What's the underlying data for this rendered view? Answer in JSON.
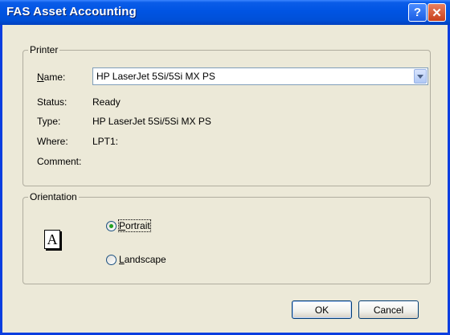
{
  "window": {
    "title": "FAS Asset Accounting",
    "help_glyph": "?",
    "close_glyph": "✕"
  },
  "printer": {
    "legend": "Printer",
    "name_label_underlined": "N",
    "name_label_rest": "ame:",
    "name_value": "HP LaserJet 5Si/5Si MX PS",
    "status_label": "Status:",
    "status_value": "Ready",
    "type_label": "Type:",
    "type_value": "HP LaserJet 5Si/5Si MX PS",
    "where_label": "Where:",
    "where_value": "LPT1:",
    "comment_label": "Comment:",
    "comment_value": ""
  },
  "orientation": {
    "legend": "Orientation",
    "icon_glyph": "A",
    "portrait_underlined": "P",
    "portrait_rest": "ortrait",
    "landscape_underlined": "L",
    "landscape_rest": "andscape",
    "selected": "portrait"
  },
  "buttons": {
    "ok": "OK",
    "cancel": "Cancel"
  }
}
